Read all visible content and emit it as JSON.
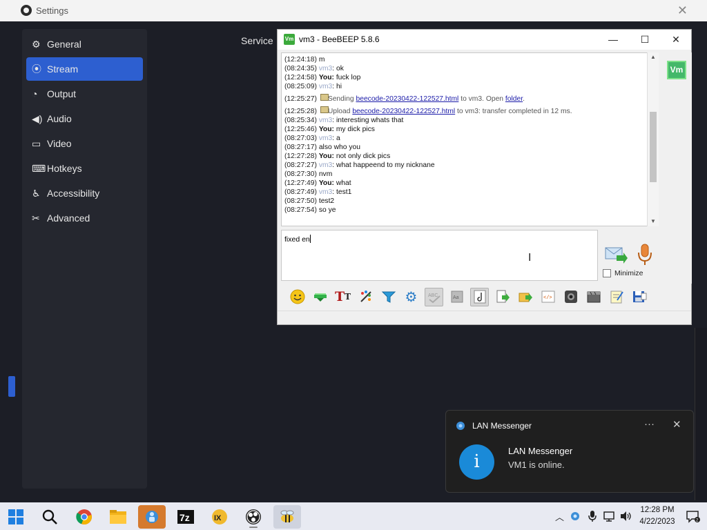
{
  "obs": {
    "title": "Settings",
    "nav": [
      {
        "label": "General",
        "icon": "gear-icon"
      },
      {
        "label": "Stream",
        "icon": "broadcast-icon",
        "active": true
      },
      {
        "label": "Output",
        "icon": "output-icon"
      },
      {
        "label": "Audio",
        "icon": "speaker-icon"
      },
      {
        "label": "Video",
        "icon": "monitor-icon"
      },
      {
        "label": "Hotkeys",
        "icon": "keyboard-icon"
      },
      {
        "label": "Accessibility",
        "icon": "accessibility-icon"
      },
      {
        "label": "Advanced",
        "icon": "tools-icon"
      }
    ],
    "service_label": "Service"
  },
  "beebeep": {
    "title": "vm3 - BeeBEEP 5.8.6",
    "user_badge": "Vm",
    "chat": [
      {
        "time": "(12:24:18)",
        "sender": "",
        "text": "m"
      },
      {
        "time": "(08:24:35)",
        "sender": "vm3",
        "text": ": ok"
      },
      {
        "time": "(12:24:58)",
        "sender": "You:",
        "text": " fuck lop"
      },
      {
        "time": "(08:25:09)",
        "sender": "vm3",
        "text": ": hi"
      },
      {
        "time": "(12:25:27)",
        "type": "file",
        "pre": "Sending ",
        "link": "beecode-20230422-122527.html",
        "mid": " to vm3. Open ",
        "link2": "folder",
        "post": "."
      },
      {
        "time": "(12:25:28)",
        "type": "file",
        "pre": "Upload ",
        "link": "beecode-20230422-122527.html",
        "mid": " to vm3: transfer completed in 12 ms.",
        "link2": "",
        "post": ""
      },
      {
        "time": "(08:25:34)",
        "sender": "vm3",
        "text": ": interesting whats that"
      },
      {
        "time": "(12:25:46)",
        "sender": "You:",
        "text": " my dick pics"
      },
      {
        "time": "(08:27:03)",
        "sender": "vm3",
        "text": ": a"
      },
      {
        "time": "(08:27:17)",
        "sender": "",
        "text": "also who you"
      },
      {
        "time": "(12:27:28)",
        "sender": "You:",
        "text": " not only dick pics"
      },
      {
        "time": "(08:27:27)",
        "sender": "vm3",
        "text": ": what happeend to my nicknane"
      },
      {
        "time": "(08:27:30)",
        "sender": "",
        "text": "nvm"
      },
      {
        "time": "(12:27:49)",
        "sender": "You:",
        "text": " what"
      },
      {
        "time": "(08:27:49)",
        "sender": "vm3",
        "text": ": test1"
      },
      {
        "time": "(08:27:50)",
        "sender": "",
        "text": "test2"
      },
      {
        "time": "(08:27:54)",
        "sender": "",
        "text": "so ye"
      }
    ],
    "input_value": "fixed en",
    "minimize_label": "Minimize",
    "toolbar_icons": [
      "smiley-icon",
      "highlighter-icon",
      "font-icon",
      "color-palette-icon",
      "filter-icon",
      "settings-gear-icon",
      "spellcheck-icon",
      "dictionary-icon",
      "music-note-icon",
      "send-file-icon",
      "send-folder-icon",
      "code-icon",
      "screenshot-icon",
      "film-icon",
      "notes-icon",
      "save-icon"
    ]
  },
  "toast": {
    "app_name": "LAN Messenger",
    "title": "LAN Messenger",
    "body": "VM1 is online."
  },
  "taskbar": {
    "time": "12:28 PM",
    "date": "4/22/2023"
  }
}
